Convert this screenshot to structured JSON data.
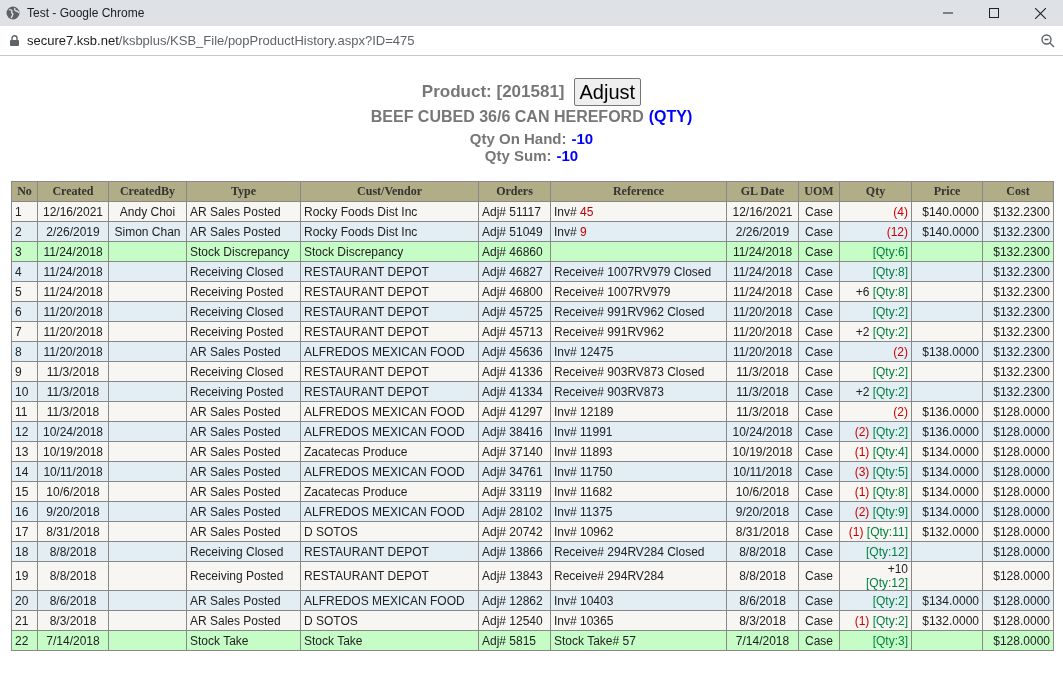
{
  "window": {
    "title": "Test - Google Chrome"
  },
  "address_bar": {
    "host": "secure7.ksb.net",
    "path": "/ksbplus/KSB_File/popProductHistory.aspx?ID=475"
  },
  "product": {
    "label": "Product: [201581]",
    "button": "Adjust",
    "name": "BEEF CUBED 36/6 CAN HEREFORD",
    "unit_link": "(QTY)",
    "on_hand_label": "Qty On Hand:",
    "on_hand_value": "-10",
    "sum_label": "Qty Sum:",
    "sum_value": "-10"
  },
  "table": {
    "columns": [
      "No",
      "Created",
      "CreatedBy",
      "Type",
      "Cust/Vendor",
      "Orders",
      "Reference",
      "GL Date",
      "UOM",
      "Qty",
      "Price",
      "Cost"
    ],
    "rows": [
      {
        "no": "1",
        "created": "12/16/2021",
        "created_by": "Andy Choi",
        "type": "AR Sales Posted",
        "cust_vendor": "Rocky Foods Dist Inc",
        "order": "Adj# 51117",
        "reference": "Inv#",
        "reference_link": "45",
        "gl_date": "12/16/2021",
        "uom": "Case",
        "qty_change": "(4)",
        "qty_change_negative": true,
        "price": "$140.0000",
        "cost": "$132.2300",
        "highlighted": false
      },
      {
        "no": "2",
        "created": "2/26/2019",
        "created_by": "Simon Chan",
        "type": "AR Sales Posted",
        "cust_vendor": "Rocky Foods Dist Inc",
        "order": "Adj# 51049",
        "reference": "Inv#",
        "reference_link": "9",
        "gl_date": "2/26/2019",
        "uom": "Case",
        "qty_change": "(12)",
        "qty_change_negative": true,
        "price": "$140.0000",
        "cost": "$132.2300",
        "highlighted": false
      },
      {
        "no": "3",
        "created": "11/24/2018",
        "type": "Stock Discrepancy",
        "cust_vendor": "Stock Discrepancy",
        "order": "Adj# 46860",
        "gl_date": "11/24/2018",
        "uom": "Case",
        "qty_balance": "[Qty:6]",
        "cost": "$132.2300",
        "highlighted": true
      },
      {
        "no": "4",
        "created": "11/24/2018",
        "type": "Receiving Closed",
        "cust_vendor": "RESTAURANT DEPOT",
        "order": "Adj# 46827",
        "reference": "Receive# 1007RV979 Closed",
        "gl_date": "11/24/2018",
        "uom": "Case",
        "qty_balance": "[Qty:8]",
        "cost": "$132.2300",
        "highlighted": false
      },
      {
        "no": "5",
        "created": "11/24/2018",
        "type": "Receiving Posted",
        "cust_vendor": "RESTAURANT DEPOT",
        "order": "Adj# 46800",
        "reference": "Receive# 1007RV979",
        "gl_date": "11/24/2018",
        "uom": "Case",
        "qty_change": "+6",
        "qty_change_negative": false,
        "qty_balance": "[Qty:8]",
        "cost": "$132.2300",
        "highlighted": false
      },
      {
        "no": "6",
        "created": "11/20/2018",
        "type": "Receiving Closed",
        "cust_vendor": "RESTAURANT DEPOT",
        "order": "Adj# 45725",
        "reference": "Receive# 991RV962 Closed",
        "gl_date": "11/20/2018",
        "uom": "Case",
        "qty_balance": "[Qty:2]",
        "cost": "$132.2300",
        "highlighted": false
      },
      {
        "no": "7",
        "created": "11/20/2018",
        "type": "Receiving Posted",
        "cust_vendor": "RESTAURANT DEPOT",
        "order": "Adj# 45713",
        "reference": "Receive# 991RV962",
        "gl_date": "11/20/2018",
        "uom": "Case",
        "qty_change": "+2",
        "qty_change_negative": false,
        "qty_balance": "[Qty:2]",
        "cost": "$132.2300",
        "highlighted": false
      },
      {
        "no": "8",
        "created": "11/20/2018",
        "type": "AR Sales Posted",
        "cust_vendor": "ALFREDOS MEXICAN FOOD",
        "order": "Adj# 45636",
        "reference": "Inv# 12475",
        "gl_date": "11/20/2018",
        "uom": "Case",
        "qty_change": "(2)",
        "qty_change_negative": true,
        "price": "$138.0000",
        "cost": "$132.2300",
        "highlighted": false
      },
      {
        "no": "9",
        "created": "11/3/2018",
        "type": "Receiving Closed",
        "cust_vendor": "RESTAURANT DEPOT",
        "order": "Adj# 41336",
        "reference": "Receive# 903RV873 Closed",
        "gl_date": "11/3/2018",
        "uom": "Case",
        "qty_balance": "[Qty:2]",
        "cost": "$132.2300",
        "highlighted": false
      },
      {
        "no": "10",
        "created": "11/3/2018",
        "type": "Receiving Posted",
        "cust_vendor": "RESTAURANT DEPOT",
        "order": "Adj# 41334",
        "reference": "Receive# 903RV873",
        "gl_date": "11/3/2018",
        "uom": "Case",
        "qty_change": "+2",
        "qty_change_negative": false,
        "qty_balance": "[Qty:2]",
        "cost": "$132.2300",
        "highlighted": false
      },
      {
        "no": "11",
        "created": "11/3/2018",
        "type": "AR Sales Posted",
        "cust_vendor": "ALFREDOS MEXICAN FOOD",
        "order": "Adj# 41297",
        "reference": "Inv# 12189",
        "gl_date": "11/3/2018",
        "uom": "Case",
        "qty_change": "(2)",
        "qty_change_negative": true,
        "price": "$136.0000",
        "cost": "$128.0000",
        "highlighted": false
      },
      {
        "no": "12",
        "created": "10/24/2018",
        "type": "AR Sales Posted",
        "cust_vendor": "ALFREDOS MEXICAN FOOD",
        "order": "Adj# 38416",
        "reference": "Inv# 11991",
        "gl_date": "10/24/2018",
        "uom": "Case",
        "qty_change": "(2)",
        "qty_change_negative": true,
        "qty_balance": "[Qty:2]",
        "price": "$136.0000",
        "cost": "$128.0000",
        "highlighted": false
      },
      {
        "no": "13",
        "created": "10/19/2018",
        "type": "AR Sales Posted",
        "cust_vendor": "Zacatecas Produce",
        "order": "Adj# 37140",
        "reference": "Inv# 11893",
        "gl_date": "10/19/2018",
        "uom": "Case",
        "qty_change": "(1)",
        "qty_change_negative": true,
        "qty_balance": "[Qty:4]",
        "price": "$134.0000",
        "cost": "$128.0000",
        "highlighted": false
      },
      {
        "no": "14",
        "created": "10/11/2018",
        "type": "AR Sales Posted",
        "cust_vendor": "ALFREDOS MEXICAN FOOD",
        "order": "Adj# 34761",
        "reference": "Inv# 11750",
        "gl_date": "10/11/2018",
        "uom": "Case",
        "qty_change": "(3)",
        "qty_change_negative": true,
        "qty_balance": "[Qty:5]",
        "price": "$134.0000",
        "cost": "$128.0000",
        "highlighted": false
      },
      {
        "no": "15",
        "created": "10/6/2018",
        "type": "AR Sales Posted",
        "cust_vendor": "Zacatecas Produce",
        "order": "Adj# 33119",
        "reference": "Inv# 11682",
        "gl_date": "10/6/2018",
        "uom": "Case",
        "qty_change": "(1)",
        "qty_change_negative": true,
        "qty_balance": "[Qty:8]",
        "price": "$134.0000",
        "cost": "$128.0000",
        "highlighted": false
      },
      {
        "no": "16",
        "created": "9/20/2018",
        "type": "AR Sales Posted",
        "cust_vendor": "ALFREDOS MEXICAN FOOD",
        "order": "Adj# 28102",
        "reference": "Inv# 11375",
        "gl_date": "9/20/2018",
        "uom": "Case",
        "qty_change": "(2)",
        "qty_change_negative": true,
        "qty_balance": "[Qty:9]",
        "price": "$134.0000",
        "cost": "$128.0000",
        "highlighted": false
      },
      {
        "no": "17",
        "created": "8/31/2018",
        "type": "AR Sales Posted",
        "cust_vendor": "D SOTOS",
        "order": "Adj# 20742",
        "reference": "Inv# 10962",
        "gl_date": "8/31/2018",
        "uom": "Case",
        "qty_change": "(1)",
        "qty_change_negative": true,
        "qty_balance": "[Qty:11]",
        "price": "$132.0000",
        "cost": "$128.0000",
        "highlighted": false
      },
      {
        "no": "18",
        "created": "8/8/2018",
        "type": "Receiving Closed",
        "cust_vendor": "RESTAURANT DEPOT",
        "order": "Adj# 13866",
        "reference": "Receive# 294RV284 Closed",
        "gl_date": "8/8/2018",
        "uom": "Case",
        "qty_balance": "[Qty:12]",
        "cost": "$128.0000",
        "highlighted": false
      },
      {
        "no": "19",
        "created": "8/8/2018",
        "type": "Receiving Posted",
        "cust_vendor": "RESTAURANT DEPOT",
        "order": "Adj# 13843",
        "reference": "Receive# 294RV284",
        "gl_date": "8/8/2018",
        "uom": "Case",
        "qty_change": "+10",
        "qty_change_negative": false,
        "qty_balance": "[Qty:12]",
        "cost": "$128.0000",
        "highlighted": false
      },
      {
        "no": "20",
        "created": "8/6/2018",
        "type": "AR Sales Posted",
        "cust_vendor": "ALFREDOS MEXICAN FOOD",
        "order": "Adj# 12862",
        "reference": "Inv# 10403",
        "gl_date": "8/6/2018",
        "uom": "Case",
        "qty_balance": "[Qty:2]",
        "price": "$134.0000",
        "cost": "$128.0000",
        "highlighted": false
      },
      {
        "no": "21",
        "created": "8/3/2018",
        "type": "AR Sales Posted",
        "cust_vendor": "D SOTOS",
        "order": "Adj# 12540",
        "reference": "Inv# 10365",
        "gl_date": "8/3/2018",
        "uom": "Case",
        "qty_change": "(1)",
        "qty_change_negative": true,
        "qty_balance": "[Qty:2]",
        "price": "$132.0000",
        "cost": "$128.0000",
        "highlighted": false
      },
      {
        "no": "22",
        "created": "7/14/2018",
        "type": "Stock Take",
        "cust_vendor": "Stock Take",
        "order": "Adj# 5815",
        "reference": "Stock Take# 57",
        "gl_date": "7/14/2018",
        "uom": "Case",
        "qty_balance": "[Qty:3]",
        "cost": "$128.0000",
        "highlighted": true
      }
    ]
  }
}
